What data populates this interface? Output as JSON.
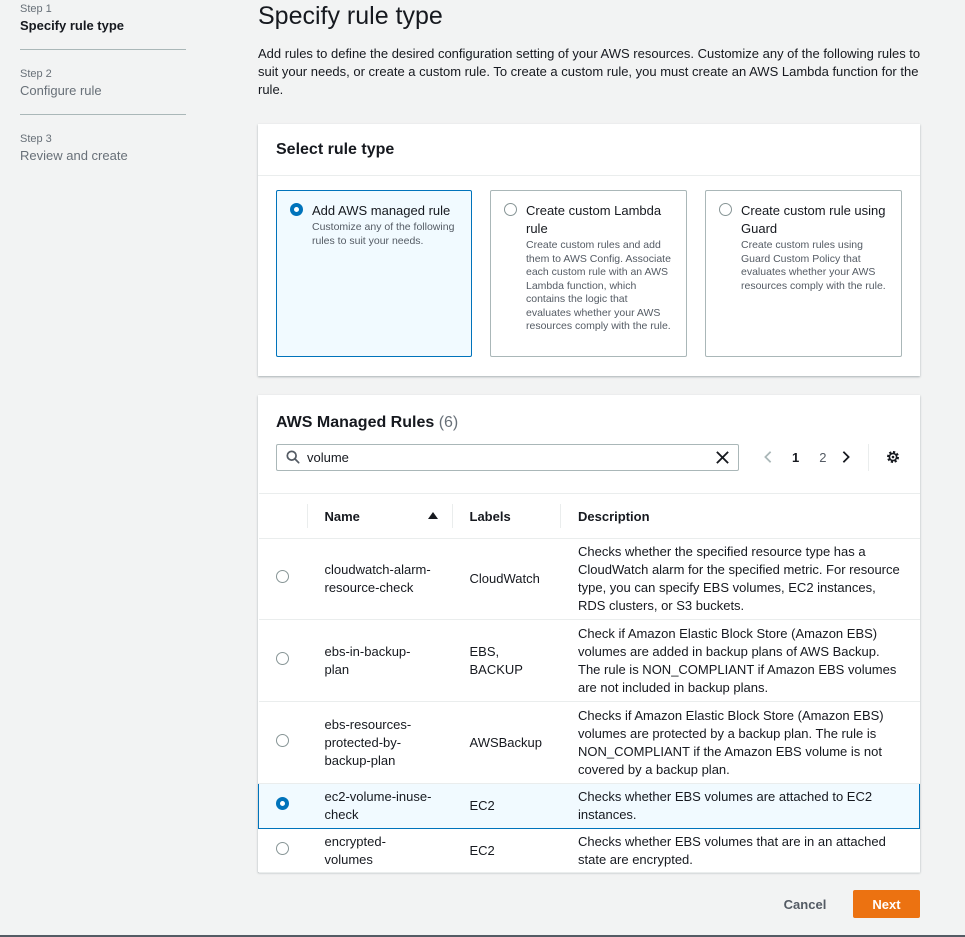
{
  "steps": [
    {
      "num": "Step 1",
      "label": "Specify rule type"
    },
    {
      "num": "Step 2",
      "label": "Configure rule"
    },
    {
      "num": "Step 3",
      "label": "Review and create"
    }
  ],
  "page": {
    "title": "Specify rule type",
    "intro": "Add rules to define the desired configuration setting of your AWS resources. Customize any of the following rules to suit your needs, or create a custom rule. To create a custom rule, you must create an AWS Lambda function for the rule."
  },
  "rule_type": {
    "title": "Select rule type",
    "tiles": [
      {
        "title": "Add AWS managed rule",
        "desc": "Customize any of the following rules to suit your needs.",
        "selected": true
      },
      {
        "title": "Create custom Lambda rule",
        "desc": "Create custom rules and add them to AWS Config. Associate each custom rule with an AWS Lambda function, which contains the logic that evaluates whether your AWS resources comply with the rule.",
        "selected": false
      },
      {
        "title": "Create custom rule using Guard",
        "desc": "Create custom rules using Guard Custom Policy that evaluates whether your AWS resources comply with the rule.",
        "selected": false
      }
    ]
  },
  "managed_rules": {
    "title": "AWS Managed Rules",
    "count": "(6)",
    "search_value": "volume",
    "pagination": {
      "pages": [
        "1",
        "2"
      ],
      "current": "1"
    },
    "columns": {
      "name": "Name",
      "labels": "Labels",
      "description": "Description"
    },
    "rows": [
      {
        "name": "cloudwatch-alarm-resource-check",
        "labels": "CloudWatch",
        "description": "Checks whether the specified resource type has a CloudWatch alarm for the specified metric. For resource type, you can specify EBS volumes, EC2 instances, RDS clusters, or S3 buckets.",
        "selected": false
      },
      {
        "name": "ebs-in-backup-plan",
        "labels": "EBS, BACKUP",
        "description": "Check if Amazon Elastic Block Store (Amazon EBS) volumes are added in backup plans of AWS Backup. The rule is NON_COMPLIANT if Amazon EBS volumes are not included in backup plans.",
        "selected": false
      },
      {
        "name": "ebs-resources-protected-by-backup-plan",
        "labels": "AWSBackup",
        "description": "Checks if Amazon Elastic Block Store (Amazon EBS) volumes are protected by a backup plan. The rule is NON_COMPLIANT if the Amazon EBS volume is not covered by a backup plan.",
        "selected": false
      },
      {
        "name": "ec2-volume-inuse-check",
        "labels": "EC2",
        "description": "Checks whether EBS volumes are attached to EC2 instances.",
        "selected": true
      },
      {
        "name": "encrypted-volumes",
        "labels": "EC2",
        "description": "Checks whether EBS volumes that are in an attached state are encrypted.",
        "selected": false
      }
    ]
  },
  "actions": {
    "cancel": "Cancel",
    "next": "Next"
  },
  "colors": {
    "accent": "#0073bb",
    "primary_button": "#ec7211",
    "selected_bg": "#f1faff"
  }
}
